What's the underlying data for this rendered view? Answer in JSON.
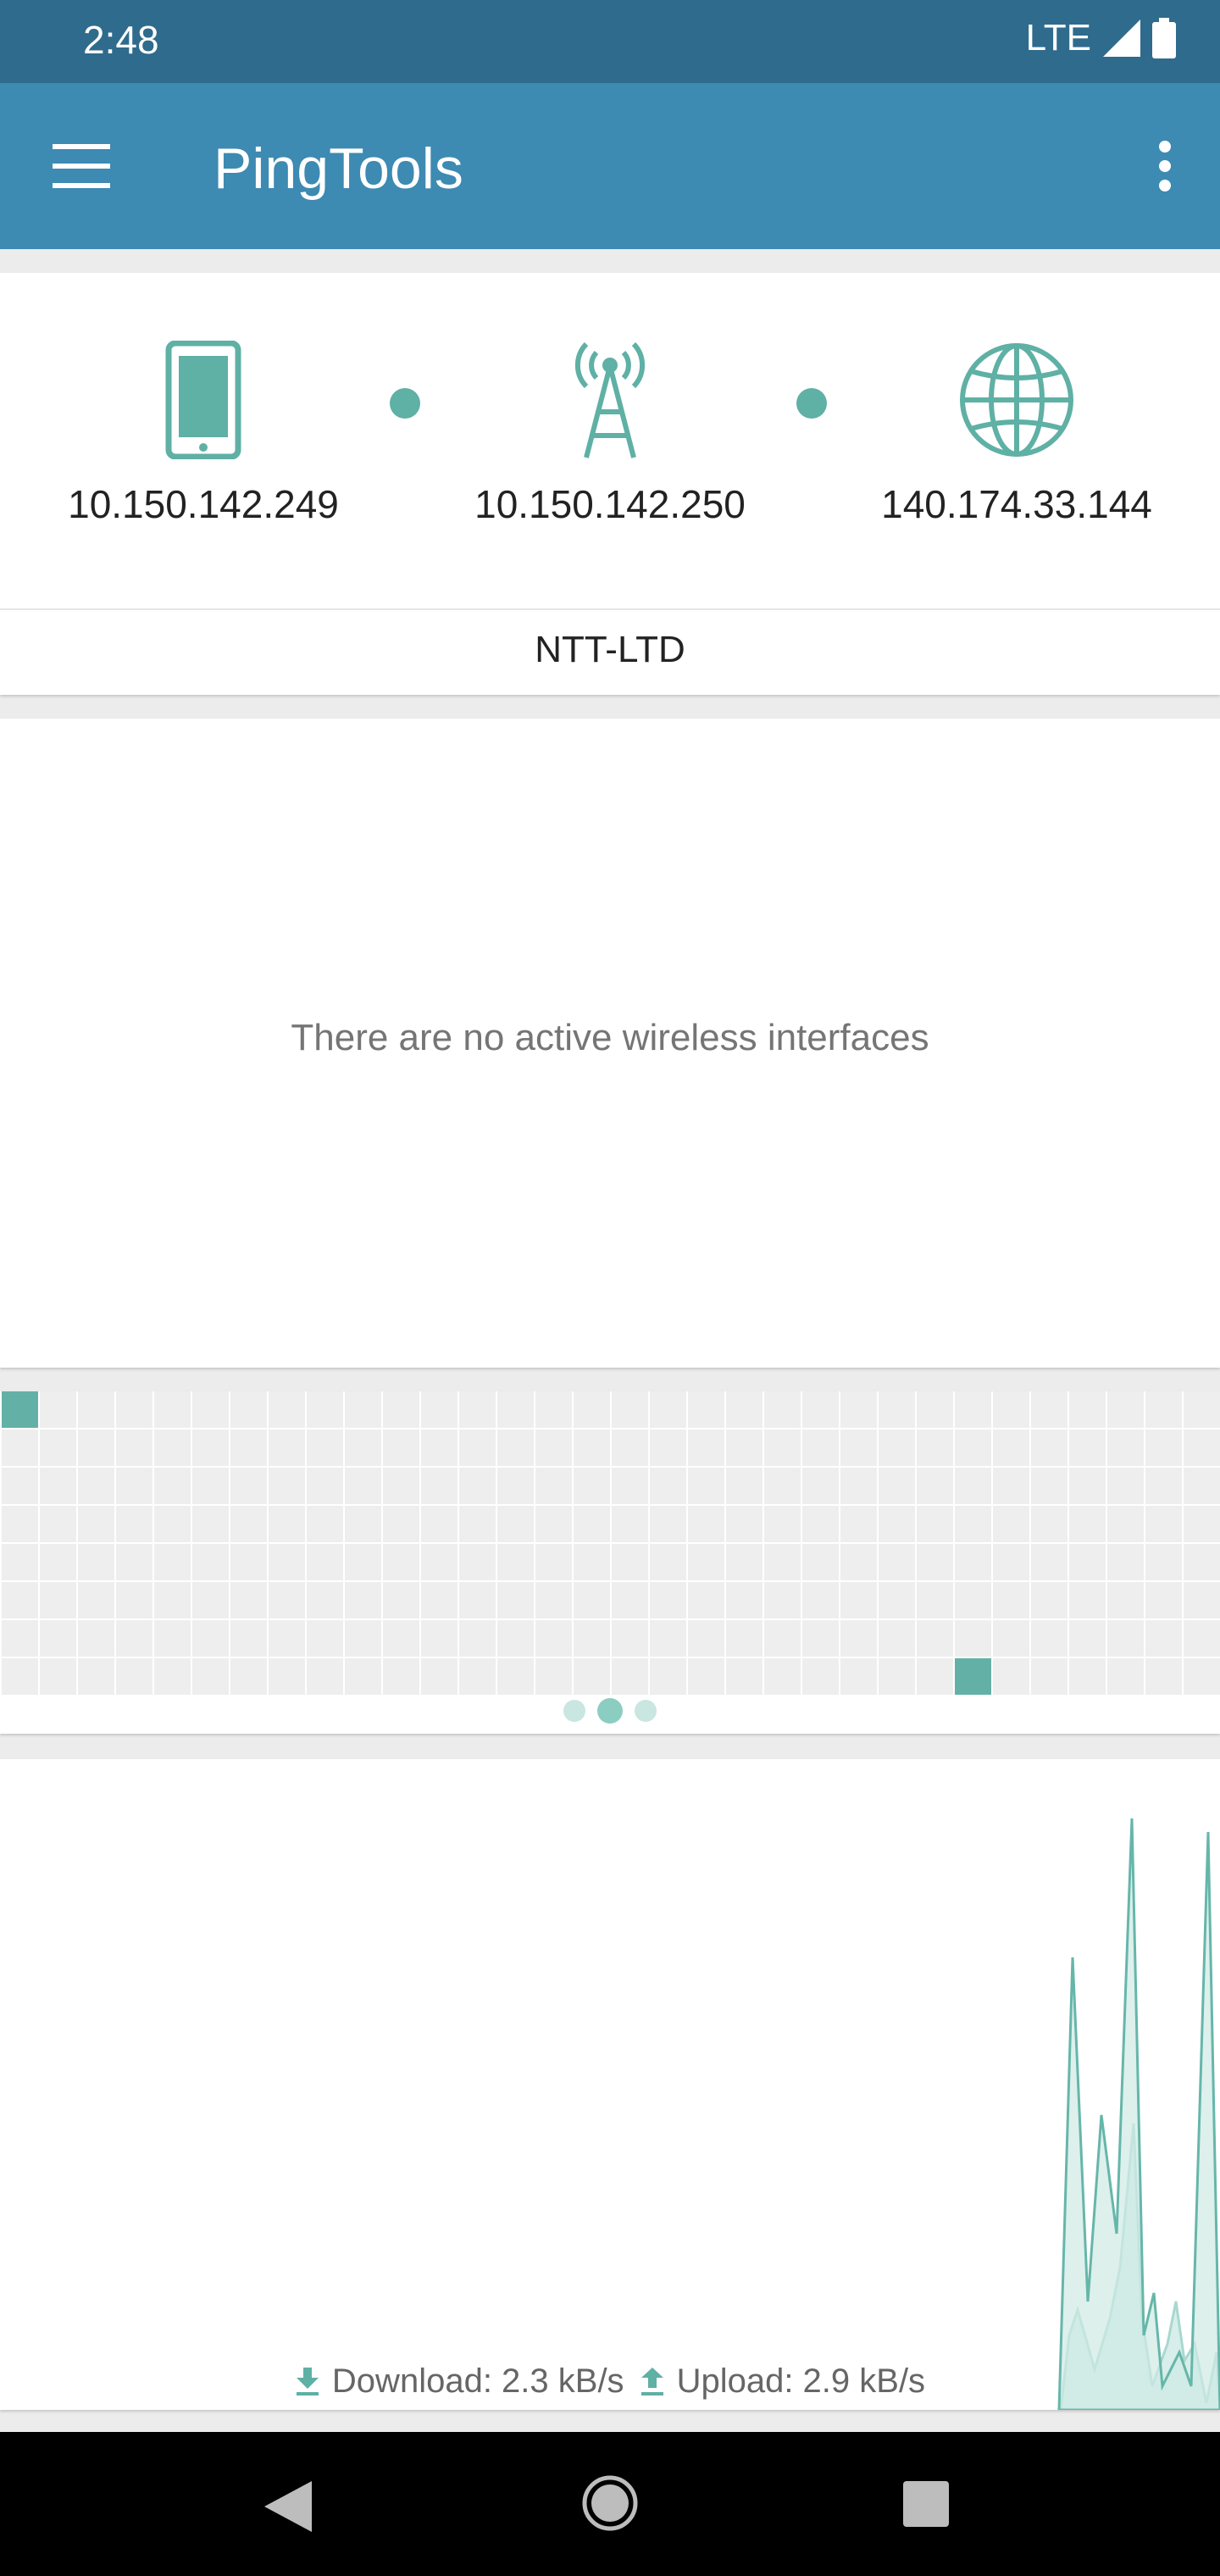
{
  "status_bar": {
    "time": "2:48",
    "network": "LTE"
  },
  "app_bar": {
    "title": "PingTools"
  },
  "network_path": {
    "nodes": [
      {
        "icon": "phone-icon",
        "ip": "10.150.142.249"
      },
      {
        "icon": "cell-tower-icon",
        "ip": "10.150.142.250"
      },
      {
        "icon": "globe-icon",
        "ip": "140.174.33.144"
      }
    ],
    "isp": "NTT-LTD"
  },
  "wireless": {
    "message": "There are no active wireless interfaces"
  },
  "channel_grid": {
    "columns": 32,
    "rows": 8,
    "active_cells": [
      {
        "row": 0,
        "col": 0
      },
      {
        "row": 7,
        "col": 25
      }
    ],
    "pages": 3,
    "current_page": 1
  },
  "traffic": {
    "download_label": "Download: 2.3 kB/s",
    "upload_label": "Upload: 2.9 kB/s"
  },
  "colors": {
    "accent": "#5fb0a5",
    "app_bar": "#3d8ab2",
    "status_bar": "#2f6b8c"
  }
}
